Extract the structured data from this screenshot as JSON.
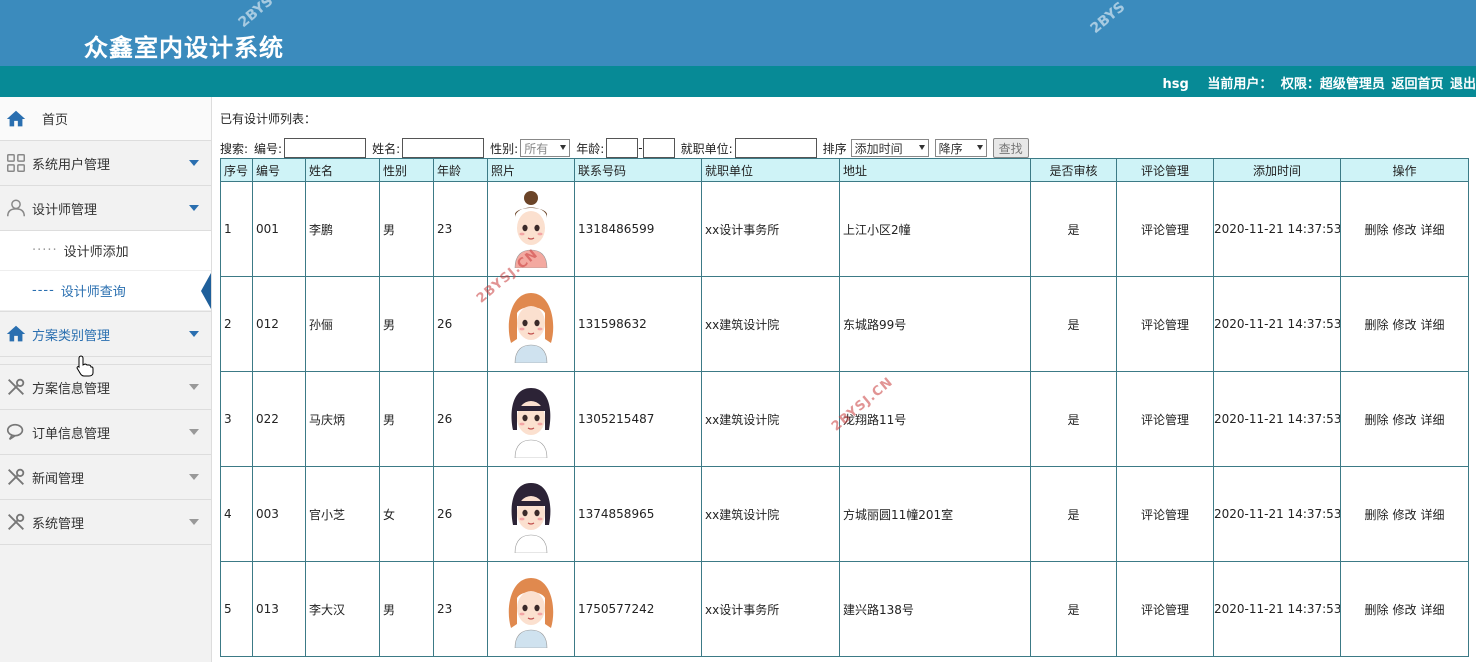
{
  "app": {
    "title": "众鑫室内设计系统",
    "watermark": "2BYSJ.CN",
    "watermark_header": "2BYS"
  },
  "userbar": {
    "username": "hsg",
    "current_user_label": "当前用户：",
    "role_label": "权限：超级管理员",
    "home_link": "返回首页",
    "logout_link": "退出"
  },
  "sidebar": {
    "home": "首页",
    "items": [
      {
        "label": "系统用户管理",
        "icon": "grid-icon"
      },
      {
        "label": "设计师管理",
        "icon": "user-icon"
      },
      {
        "label": "方案类别管理",
        "icon": "home-icon"
      },
      {
        "label": "方案信息管理",
        "icon": "tools-icon"
      },
      {
        "label": "订单信息管理",
        "icon": "chat-icon"
      },
      {
        "label": "新闻管理",
        "icon": "tools-icon"
      },
      {
        "label": "系统管理",
        "icon": "tools-icon"
      }
    ],
    "sub_items": [
      {
        "label": "设计师添加"
      },
      {
        "label": "设计师查询"
      }
    ]
  },
  "main": {
    "list_title": "已有设计师列表：",
    "search": {
      "label": "搜索:",
      "code_label": "编号:",
      "name_label": "姓名:",
      "gender_label": "性别:",
      "gender_value": "所有",
      "age_label": "年龄:",
      "age_sep": "-",
      "unit_label": "就职单位:",
      "sort_label": "排序",
      "sort_field": "添加时间",
      "sort_order": "降序",
      "search_button": "查找"
    },
    "table": {
      "headers": [
        "序号",
        "编号",
        "姓名",
        "性别",
        "年龄",
        "照片",
        "联系号码",
        "就职单位",
        "地址",
        "是否审核",
        "评论管理",
        "添加时间",
        "操作"
      ],
      "ops": {
        "delete": "删除",
        "edit": "修改",
        "detail": "详细"
      },
      "rows": [
        {
          "no": "1",
          "code": "001",
          "name": "李鹏",
          "gender": "男",
          "age": "23",
          "phone": "1318486599",
          "unit": "xx设计事务所",
          "address": "上江小区2幢",
          "approved": "是",
          "comment": "评论管理",
          "time": "2020-11-21 14:37:53",
          "avatar": "bun"
        },
        {
          "no": "2",
          "code": "012",
          "name": "孙俪",
          "gender": "男",
          "age": "26",
          "phone": "131598632",
          "unit": "xx建筑设计院",
          "address": "东城路99号",
          "approved": "是",
          "comment": "评论管理",
          "time": "2020-11-21 14:37:53",
          "avatar": "ginger"
        },
        {
          "no": "3",
          "code": "022",
          "name": "马庆炳",
          "gender": "男",
          "age": "26",
          "phone": "1305215487",
          "unit": "xx建筑设计院",
          "address": "龙翔路11号",
          "approved": "是",
          "comment": "评论管理",
          "time": "2020-11-21 14:37:53",
          "avatar": "dark"
        },
        {
          "no": "4",
          "code": "003",
          "name": "官小芝",
          "gender": "女",
          "age": "26",
          "phone": "1374858965",
          "unit": "xx建筑设计院",
          "address": "方城丽圆11幢201室",
          "approved": "是",
          "comment": "评论管理",
          "time": "2020-11-21 14:37:53",
          "avatar": "dark"
        },
        {
          "no": "5",
          "code": "013",
          "name": "李大汉",
          "gender": "男",
          "age": "23",
          "phone": "1750577242",
          "unit": "xx设计事务所",
          "address": "建兴路138号",
          "approved": "是",
          "comment": "评论管理",
          "time": "2020-11-21 14:37:53",
          "avatar": "ginger"
        }
      ]
    }
  },
  "colors": {
    "header": "#3b8bbd",
    "userbar": "#078a96",
    "table_header": "#cff3f7",
    "table_border": "#3c7a86",
    "accent": "#2a6fb0"
  }
}
